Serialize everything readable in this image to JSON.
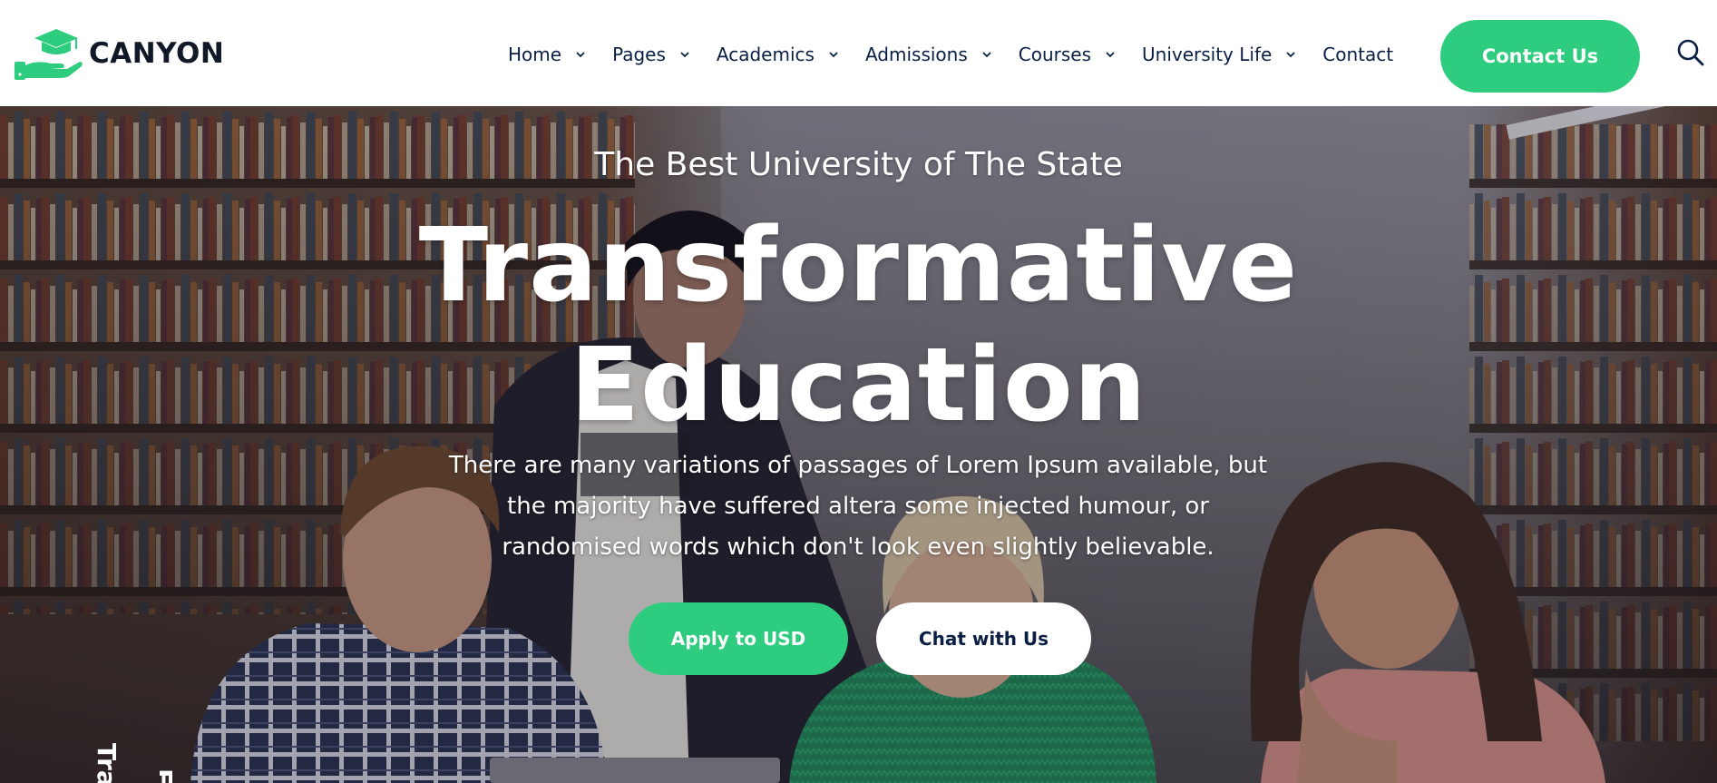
{
  "brand": {
    "name": "CANYON",
    "accent_color": "#2ecc7e",
    "text_color": "#0b1f44",
    "logo_icon": "graduation-cap-hand-icon"
  },
  "nav": {
    "items": [
      {
        "label": "Home",
        "has_dropdown": true
      },
      {
        "label": "Pages",
        "has_dropdown": true
      },
      {
        "label": "Academics",
        "has_dropdown": true
      },
      {
        "label": "Admissions",
        "has_dropdown": true
      },
      {
        "label": "Courses",
        "has_dropdown": true
      },
      {
        "label": "University Life",
        "has_dropdown": true
      },
      {
        "label": "Contact",
        "has_dropdown": false
      }
    ],
    "cta_label": "Contact Us",
    "search_icon": "search-icon"
  },
  "hero": {
    "eyebrow": "The Best University of The State",
    "headline_line1": "Transformative",
    "headline_line2": "Education",
    "lead": "There are many variations of passages of Lorem Ipsum available, but the majority have suffered altera some injected humour, or randomised words which don't look even slightly believable.",
    "primary_button": "Apply to USD",
    "secondary_button": "Chat with Us",
    "vertical_label_1": "Tra",
    "vertical_label_2": "E"
  }
}
